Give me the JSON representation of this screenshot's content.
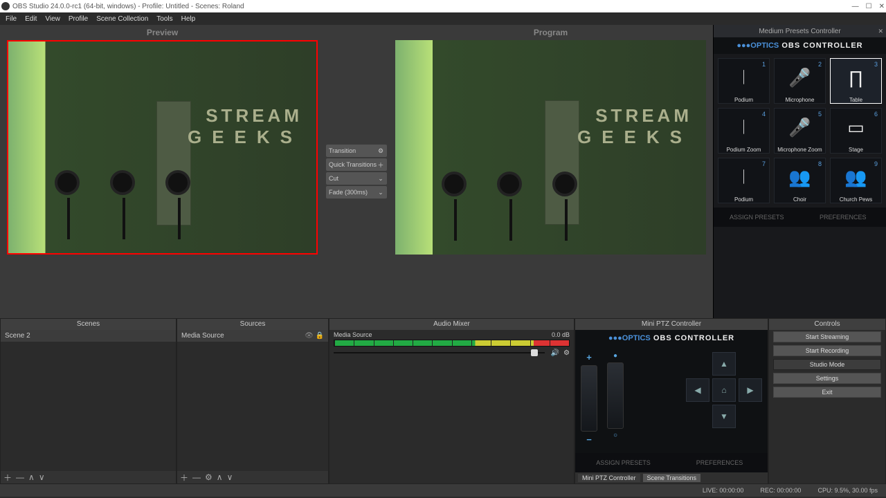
{
  "window": {
    "title": "OBS Studio 24.0.0-rc1 (64-bit, windows) - Profile: Untitled - Scenes: Roland"
  },
  "menu": {
    "file": "File",
    "edit": "Edit",
    "view": "View",
    "profile": "Profile",
    "scenecol": "Scene Collection",
    "tools": "Tools",
    "help": "Help"
  },
  "preview": {
    "title": "Preview"
  },
  "program": {
    "title": "Program"
  },
  "wall_text1": "STREAM",
  "wall_text2": "GEEKS",
  "transitions": {
    "label": "Transition",
    "quick": "Quick Transitions",
    "cut": "Cut",
    "fade": "Fade (300ms)"
  },
  "presets_panel": {
    "title": "Medium Presets Controller",
    "brand1": "●●●OPTICS",
    "brand2": "OBS CONTROLLER",
    "cells": [
      {
        "label": "Podium",
        "num": "1"
      },
      {
        "label": "Microphone",
        "num": "2"
      },
      {
        "label": "Table",
        "num": "3"
      },
      {
        "label": "Podium Zoom",
        "num": "4"
      },
      {
        "label": "Microphone Zoom",
        "num": "5"
      },
      {
        "label": "Stage",
        "num": "6"
      },
      {
        "label": "Podium",
        "num": "7"
      },
      {
        "label": "Choir",
        "num": "8"
      },
      {
        "label": "Church Pews",
        "num": "9"
      }
    ],
    "assign": "ASSIGN PRESETS",
    "prefs": "PREFERENCES"
  },
  "scenes": {
    "title": "Scenes",
    "items": [
      "Scene 2"
    ]
  },
  "sources": {
    "title": "Sources",
    "items": [
      "Media Source"
    ]
  },
  "mixer": {
    "title": "Audio Mixer",
    "src": "Media Source",
    "level": "0.0 dB"
  },
  "ptz": {
    "title": "Mini PTZ Controller",
    "brand1": "●●●OPTICS",
    "brand2": "OBS CONTROLLER",
    "assign": "ASSIGN PRESETS",
    "prefs": "PREFERENCES",
    "tab1": "Mini PTZ Controller",
    "tab2": "Scene Transitions"
  },
  "controls": {
    "title": "Controls",
    "start_stream": "Start Streaming",
    "start_rec": "Start Recording",
    "studio": "Studio Mode",
    "settings": "Settings",
    "exit": "Exit"
  },
  "status": {
    "live": "LIVE: 00:00:00",
    "rec": "REC: 00:00:00",
    "cpu": "CPU: 9.5%, 30.00 fps"
  }
}
